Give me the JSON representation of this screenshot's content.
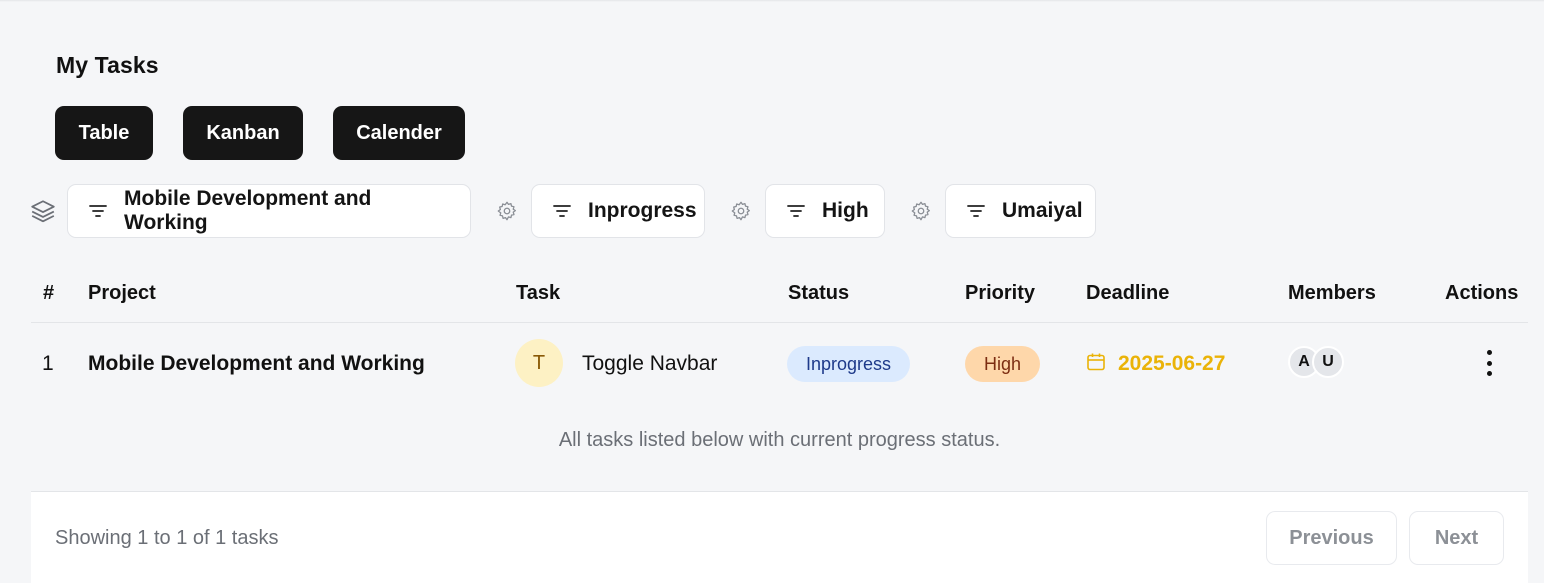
{
  "page": {
    "title": "My Tasks"
  },
  "views": {
    "table": "Table",
    "kanban": "Kanban",
    "calender": "Calender"
  },
  "filters": {
    "project": "Mobile Development and Working",
    "status": "Inprogress",
    "priority": "High",
    "member": "Umaiyal"
  },
  "table": {
    "columns": {
      "index": "#",
      "project": "Project",
      "task": "Task",
      "status": "Status",
      "priority": "Priority",
      "deadline": "Deadline",
      "members": "Members",
      "actions": "Actions"
    },
    "rows": [
      {
        "index": "1",
        "project": "Mobile Development and Working",
        "task_initial": "T",
        "task": "Toggle Navbar",
        "status": "Inprogress",
        "priority": "High",
        "deadline": "2025-06-27",
        "members": [
          "A",
          "U"
        ]
      }
    ],
    "caption": "All tasks listed below with current progress status."
  },
  "pagination": {
    "summary": "Showing 1 to 1 of 1 tasks",
    "previous": "Previous",
    "next": "Next"
  },
  "colors": {
    "status_badge_bg": "#dbeafe",
    "status_badge_text": "#1e3a8a",
    "priority_badge_bg": "#fed7aa",
    "priority_badge_text": "#7c2d12",
    "deadline": "#eab308",
    "view_button_bg": "#161616"
  }
}
